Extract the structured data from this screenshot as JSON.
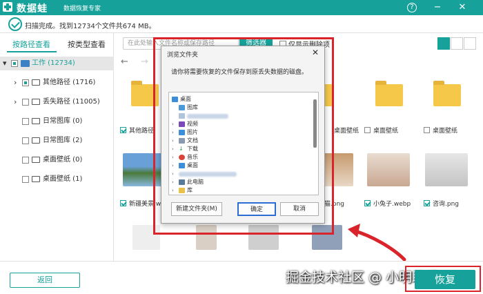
{
  "app": {
    "brand": "数据蛙",
    "subtitle": "数据恢复专家",
    "help": "?",
    "minimize": "−",
    "close": "✕"
  },
  "status": {
    "text": "扫描完成。找到12734个文件共674 MB。"
  },
  "tabs": [
    {
      "label": "按路径查看"
    },
    {
      "label": "按类型查看"
    }
  ],
  "tree": [
    {
      "label": "工作 (12734)"
    },
    {
      "label": "其他路径 (1716)"
    },
    {
      "label": "丢失路径 (11005)"
    },
    {
      "label": "日常图库 (0)"
    },
    {
      "label": "日常图库 (2)"
    },
    {
      "label": "桌面壁纸 (0)"
    },
    {
      "label": "桌面壁纸 (1)"
    }
  ],
  "toolbar": {
    "search_placeholder": "在此处输入文件名称或保存路径",
    "filter": "筛选器",
    "only_deleted": "仅显示删除项"
  },
  "grid": {
    "row1": [
      {
        "label": "其他路径"
      },
      {
        "label": "桌面壁纸"
      },
      {
        "label": "桌面壁纸"
      },
      {
        "label": "桌面壁纸"
      }
    ],
    "row2": [
      {
        "label": "新疆美景.web"
      },
      {
        "label": "猫.png"
      },
      {
        "label": "小兔子.webp"
      },
      {
        "label": "咨询.png"
      }
    ]
  },
  "dialog": {
    "title": "浏览文件夹",
    "close": "✕",
    "message": "请你将需要恢复的文件保存到原丢失数据的磁盘。",
    "items": [
      {
        "label": "桌面"
      },
      {
        "label": "图库"
      },
      {
        "label": "视频"
      },
      {
        "label": "图片"
      },
      {
        "label": "文档"
      },
      {
        "label": "下载"
      },
      {
        "label": "音乐"
      },
      {
        "label": "桌面"
      },
      {
        "label": "此电脑"
      },
      {
        "label": "库"
      }
    ],
    "new_folder": "新建文件夹(M)",
    "ok": "确定",
    "cancel": "取消"
  },
  "bottom": {
    "back": "返回",
    "watermark": "掘金技术社区 @ 小明助手",
    "recover": "恢复"
  }
}
